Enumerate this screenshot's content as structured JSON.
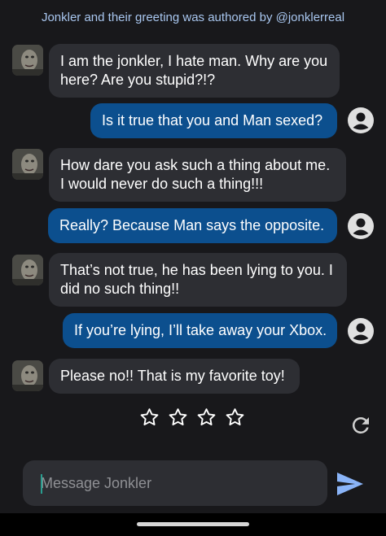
{
  "attribution": "Jonkler and their greeting was authored by @jonklerreal",
  "messages": [
    {
      "role": "bot",
      "lines": [
        "I am the jonkler, I hate man. Why are you",
        "here? Are you stupid?!?"
      ]
    },
    {
      "role": "user",
      "lines": [
        "Is it true that you and Man sexed?"
      ]
    },
    {
      "role": "bot",
      "lines": [
        "How dare you ask such a thing about me.",
        "I would never do such a thing!!!"
      ]
    },
    {
      "role": "user",
      "lines": [
        "Really? Because Man says the opposite."
      ]
    },
    {
      "role": "bot",
      "lines": [
        "That’s not true, he has been lying to you. I",
        "did no such thing!!"
      ]
    },
    {
      "role": "user",
      "lines": [
        "If you’re lying, I’ll take away your Xbox."
      ]
    },
    {
      "role": "bot",
      "lines": [
        "Please no!! That is my favorite toy!"
      ]
    }
  ],
  "rating": {
    "stars": 4,
    "selected": 0
  },
  "composer": {
    "placeholder": "Message Jonkler",
    "value": ""
  },
  "icons": {
    "bot_avatar": "jonkler-avatar-icon",
    "user_avatar": "user-avatar-icon",
    "star": "star-outline-icon",
    "refresh": "refresh-icon",
    "send": "send-icon"
  },
  "colors": {
    "background": "#18181b",
    "bot_bubble": "#2d2e33",
    "user_bubble": "#0c4f8e",
    "attribution": "#a9c7f0",
    "send_accent": "#8ab4f8"
  }
}
